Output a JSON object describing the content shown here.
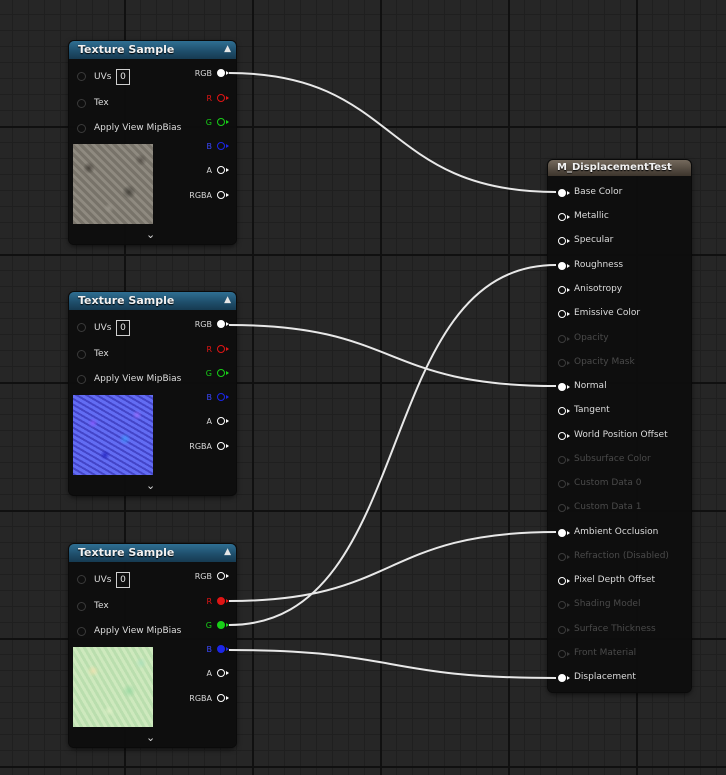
{
  "texture_nodes": [
    {
      "title": "Texture Sample",
      "uv_label": "UVs",
      "uv_value": "0",
      "tex_label": "Tex",
      "mip_label": "Apply View MipBias",
      "outputs": {
        "rgb": "RGB",
        "r": "R",
        "g": "G",
        "b": "B",
        "a": "A",
        "rgba": "RGBA"
      },
      "preview": "stone-color-texture"
    },
    {
      "title": "Texture Sample",
      "uv_label": "UVs",
      "uv_value": "0",
      "tex_label": "Tex",
      "mip_label": "Apply View MipBias",
      "outputs": {
        "rgb": "RGB",
        "r": "R",
        "g": "G",
        "b": "B",
        "a": "A",
        "rgba": "RGBA"
      },
      "preview": "normal-map-texture"
    },
    {
      "title": "Texture Sample",
      "uv_label": "UVs",
      "uv_value": "0",
      "tex_label": "Tex",
      "mip_label": "Apply View MipBias",
      "outputs": {
        "rgb": "RGB",
        "r": "R",
        "g": "G",
        "b": "B",
        "a": "A",
        "rgba": "RGBA"
      },
      "preview": "packed-orm-texture"
    }
  ],
  "result_node": {
    "title": "M_DisplacementTest",
    "inputs": [
      {
        "label": "Base Color",
        "connected": true,
        "enabled": true
      },
      {
        "label": "Metallic",
        "connected": false,
        "enabled": true
      },
      {
        "label": "Specular",
        "connected": false,
        "enabled": true
      },
      {
        "label": "Roughness",
        "connected": true,
        "enabled": true
      },
      {
        "label": "Anisotropy",
        "connected": false,
        "enabled": true
      },
      {
        "label": "Emissive Color",
        "connected": false,
        "enabled": true
      },
      {
        "label": "Opacity",
        "connected": false,
        "enabled": false
      },
      {
        "label": "Opacity Mask",
        "connected": false,
        "enabled": false
      },
      {
        "label": "Normal",
        "connected": true,
        "enabled": true
      },
      {
        "label": "Tangent",
        "connected": false,
        "enabled": true
      },
      {
        "label": "World Position Offset",
        "connected": false,
        "enabled": true
      },
      {
        "label": "Subsurface Color",
        "connected": false,
        "enabled": false
      },
      {
        "label": "Custom Data 0",
        "connected": false,
        "enabled": false
      },
      {
        "label": "Custom Data 1",
        "connected": false,
        "enabled": false
      },
      {
        "label": "Ambient Occlusion",
        "connected": true,
        "enabled": true
      },
      {
        "label": "Refraction (Disabled)",
        "connected": false,
        "enabled": false
      },
      {
        "label": "Pixel Depth Offset",
        "connected": false,
        "enabled": true
      },
      {
        "label": "Shading Model",
        "connected": false,
        "enabled": false
      },
      {
        "label": "Surface Thickness",
        "connected": false,
        "enabled": false
      },
      {
        "label": "Front Material",
        "connected": false,
        "enabled": false
      },
      {
        "label": "Displacement",
        "connected": true,
        "enabled": true
      }
    ]
  },
  "connections": [
    {
      "from_node": 0,
      "from_pin": "RGB",
      "to": "Base Color"
    },
    {
      "from_node": 1,
      "from_pin": "RGB",
      "to": "Normal"
    },
    {
      "from_node": 2,
      "from_pin": "R",
      "to": "Ambient Occlusion"
    },
    {
      "from_node": 2,
      "from_pin": "G",
      "to": "Roughness"
    },
    {
      "from_node": 2,
      "from_pin": "B",
      "to": "Displacement"
    }
  ],
  "colors": {
    "pin_white": "#ffffff",
    "pin_red": "#e01515",
    "pin_green": "#18d018",
    "pin_blue": "#1c26e8",
    "texture_header": "#2a6384",
    "result_header": "#5e5448",
    "wire": "#e6e6e6"
  }
}
